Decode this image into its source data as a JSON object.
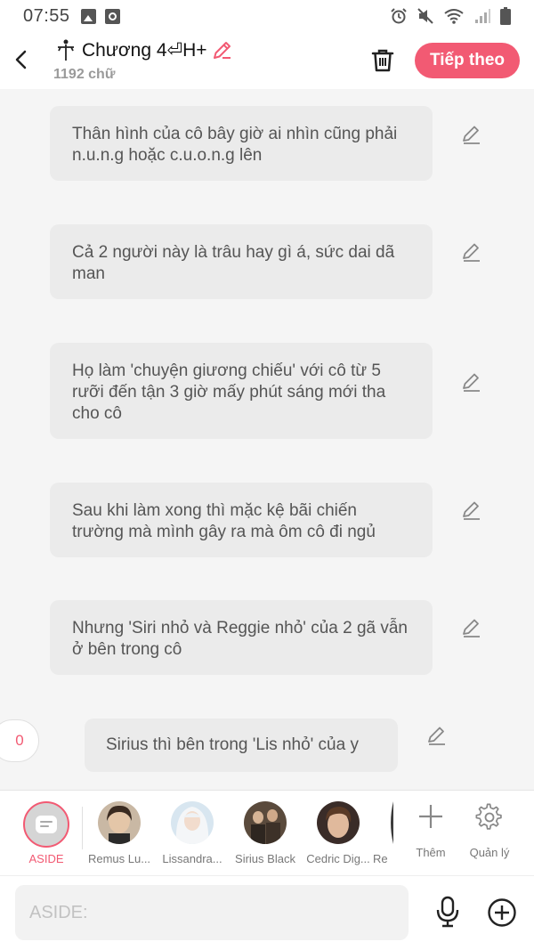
{
  "status_bar": {
    "time": "07:55"
  },
  "header": {
    "title": "Chương 4⏎H+",
    "title_icon": "cross-figure-icon",
    "word_count": "1192 chữ",
    "next_label": "Tiếp theo"
  },
  "messages": [
    {
      "text": "Thân hình của cô bây giờ ai nhìn cũng phải n.u.n.g hoặc c.u.o.n.g lên"
    },
    {
      "text": "Cả 2 người này là trâu hay gì á, sức dai dã man"
    },
    {
      "text": "Họ làm 'chuyện giương chiếu' với cô từ 5 rưỡi đến tận 3 giờ mấy phút sáng mới tha cho cô"
    },
    {
      "text": "Sau khi làm xong thì mặc kệ bãi chiến trường mà mình gây ra mà ôm cô đi ngủ"
    },
    {
      "text": "Nhưng 'Siri nhỏ và Reggie nhỏ' của 2 gã vẫn ở bên trong cô"
    },
    {
      "text": "Sirius thì bên trong 'Lis nhỏ' của y"
    }
  ],
  "counter": "0",
  "characters": {
    "aside_label": "ASIDE",
    "items": [
      {
        "name": "Remus Lu...",
        "avatar": "portrait-dark-hair"
      },
      {
        "name": "Lissandra...",
        "avatar": "portrait-white-hair"
      },
      {
        "name": "Sirius Black",
        "avatar": "portrait-group"
      },
      {
        "name": "Cedric Dig...",
        "avatar": "portrait-brown-hair"
      },
      {
        "name": "Re",
        "avatar": "portrait-partial"
      }
    ],
    "add_label": "Thêm",
    "manage_label": "Quản lý"
  },
  "input": {
    "placeholder": "ASIDE:"
  },
  "colors": {
    "accent": "#f25a73",
    "bubble": "#ebebeb",
    "background": "#f5f5f5"
  }
}
